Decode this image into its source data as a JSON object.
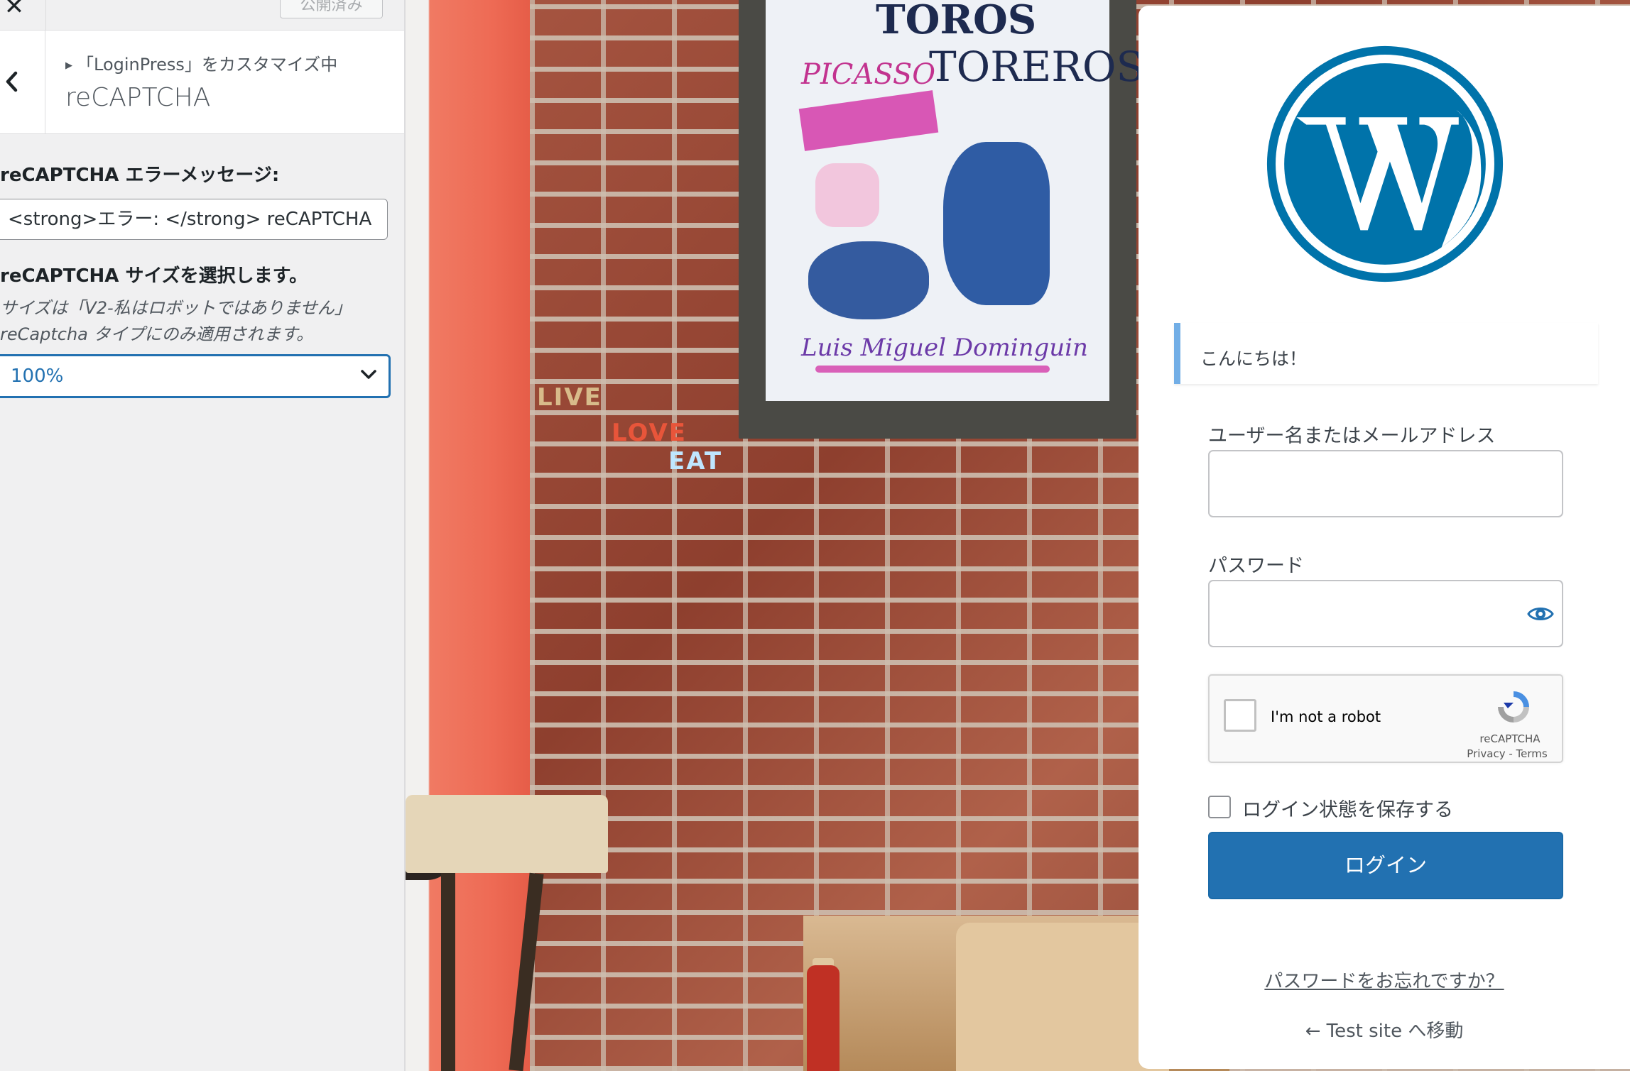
{
  "customizer": {
    "publish_label": "公開済み",
    "breadcrumb": "「LoginPress」をカスタマイズ中",
    "section_title": "reCAPTCHA",
    "error_message": {
      "label": "reCAPTCHA エラーメッセージ:",
      "value": "<strong>エラー: </strong> reCAPTCHA"
    },
    "size": {
      "label": "reCAPTCHA サイズを選択します。",
      "description_line1": "サイズは「V2-私はロボットではありません」",
      "description_line2": "reCaptcha タイプにのみ適用されます。",
      "selected": "100%"
    }
  },
  "preview_background": {
    "poster_text_1": "TOROS",
    "poster_text_2": "PICASSO",
    "poster_text_3": "TOREROS",
    "poster_signature": "Luis Miguel Dominguin",
    "chalk_live": "LIVE",
    "chalk_love": "LOVE",
    "chalk_eat": "EAT"
  },
  "login": {
    "notice": "こんにちは！",
    "username_label": "ユーザー名またはメールアドレス",
    "username_value": "",
    "password_label": "パスワード",
    "password_value": "",
    "recaptcha": {
      "checkbox_label": "I'm not a robot",
      "brand": "reCAPTCHA",
      "links": "Privacy - Terms"
    },
    "remember_label": "ログイン状態を保存する",
    "submit_label": "ログイン",
    "lost_password": "パスワードをお忘れですか？",
    "back_to_site": "← Test site へ移動"
  },
  "colors": {
    "accent": "#2271b1",
    "wp_blue": "#0073aa",
    "notice_border": "#72aee6"
  }
}
